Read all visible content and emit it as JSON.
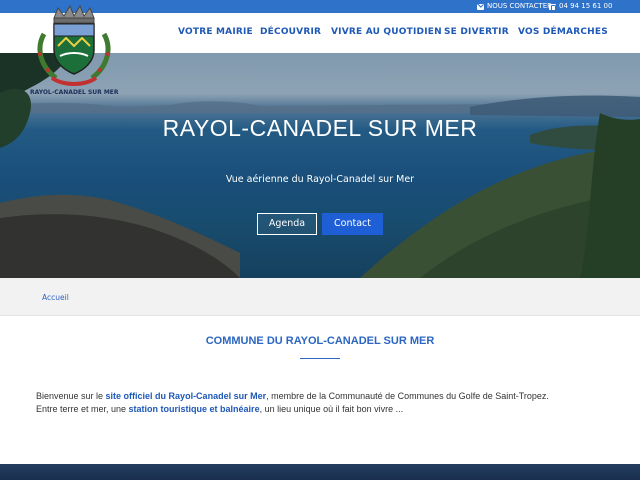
{
  "topbar": {
    "contact_label": "NOUS CONTACTER",
    "phone": "04 94 15 61 00"
  },
  "logo": {
    "text": "RAYOL-CANADEL SUR MER"
  },
  "nav": {
    "items": [
      "VOTRE MAIRIE",
      "DÉCOUVRIR",
      "VIVRE AU QUOTIDIEN",
      "SE DIVERTIR",
      "VOS DÉMARCHES"
    ]
  },
  "hero": {
    "title": "RAYOL-CANADEL SUR MER",
    "subtitle": "Vue aérienne du Rayol-Canadel sur Mer",
    "buttons": [
      "Agenda",
      "Contact"
    ]
  },
  "breadcrumb": {
    "home": "Accueil"
  },
  "main": {
    "title": "COMMUNE DU RAYOL-CANADEL SUR MER",
    "intro": {
      "p1_a": "Bienvenue sur le ",
      "p1_link": "site officiel du Rayol-Canadel sur Mer",
      "p1_b": ", membre de la Communauté de Communes du Golfe de Saint-Tropez.",
      "p2_a": "Entre terre et mer, une ",
      "p2_link": "station touristique et balnéaire",
      "p2_b": ", un lieu unique où il fait bon vivre ..."
    }
  },
  "colors": {
    "brand_blue": "#1e58b7",
    "topbar_blue": "#2f72c9",
    "button_blue": "#1f5fd6"
  }
}
